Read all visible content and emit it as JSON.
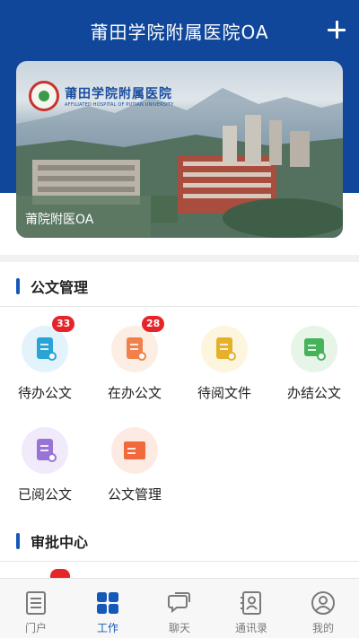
{
  "header": {
    "title": "莆田学院附属医院OA",
    "add_icon": "plus-icon",
    "color": "#11479a"
  },
  "banner": {
    "hospital_name": "莆田学院附属医院",
    "hospital_name_en": "AFFILIATED HOSPITAL OF PUTIAN UNIVERSITY",
    "caption": "莆院附医OA"
  },
  "sections": {
    "documents": {
      "title": "公文管理",
      "items": [
        {
          "label": "待办公文",
          "icon": "pending-doc-icon",
          "badge": "33",
          "color": "#2aa3d8",
          "bg": "#e3f3fb"
        },
        {
          "label": "在办公文",
          "icon": "processing-doc-icon",
          "badge": "28",
          "color": "#f2804a",
          "bg": "#fdeee4"
        },
        {
          "label": "待阅文件",
          "icon": "to-read-doc-icon",
          "badge": "",
          "color": "#e6b02b",
          "bg": "#fdf5dd"
        },
        {
          "label": "办结公文",
          "icon": "completed-doc-icon",
          "badge": "",
          "color": "#46b35a",
          "bg": "#e6f5e8"
        },
        {
          "label": "已阅公文",
          "icon": "read-doc-icon",
          "badge": "",
          "color": "#9a73d6",
          "bg": "#f0eafa"
        },
        {
          "label": "公文管理",
          "icon": "archive-box-icon",
          "badge": "",
          "color": "#f06a3c",
          "bg": "#fdebe3"
        }
      ]
    },
    "approval": {
      "title": "审批中心"
    }
  },
  "tabbar": {
    "tabs": [
      {
        "label": "门户",
        "icon": "portal-icon",
        "active": false
      },
      {
        "label": "工作",
        "icon": "work-grid-icon",
        "active": true
      },
      {
        "label": "聊天",
        "icon": "chat-icon",
        "active": false
      },
      {
        "label": "通讯录",
        "icon": "contacts-icon",
        "active": false
      },
      {
        "label": "我的",
        "icon": "profile-icon",
        "active": false
      }
    ],
    "active_color": "#1458b8",
    "inactive_color": "#7a7a7a"
  }
}
